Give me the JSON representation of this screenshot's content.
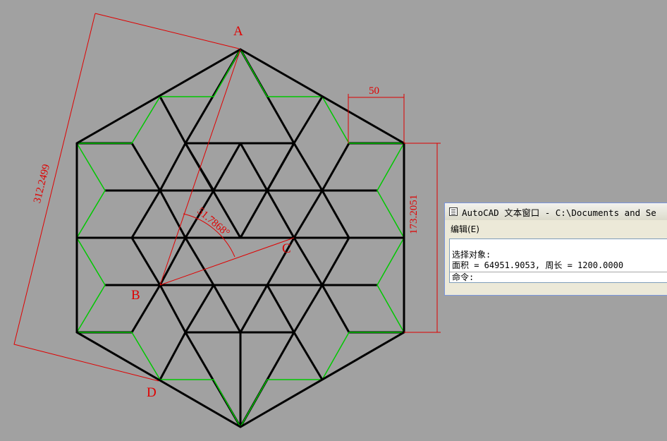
{
  "drawing": {
    "point_labels": {
      "a": "A",
      "b": "B",
      "c": "C",
      "d": "D"
    },
    "dimensions": {
      "width_50": "50",
      "height_173": "173.2051",
      "diag_312": "312.2499",
      "arc_51": "51.7868°"
    },
    "colors": {
      "background": "#a1a1a1",
      "outline": "#000000",
      "accent_lines": "#00c800",
      "dimension": "#e00000"
    }
  },
  "text_window": {
    "title": "AutoCAD 文本窗口 - C:\\Documents and Se",
    "menu_edit": "编辑(E)",
    "line1": "选择对象:",
    "line2": "面积 = 64951.9053, 周长 = 1200.0000",
    "command_prompt": "命令:"
  }
}
